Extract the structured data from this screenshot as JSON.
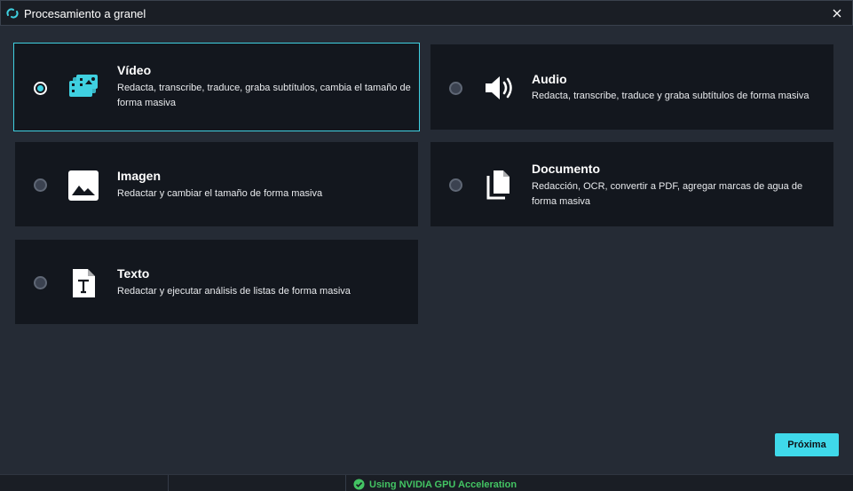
{
  "window": {
    "title": "Procesamiento a granel",
    "logo_icon": "app-logo-icon",
    "close_icon": "close-icon"
  },
  "options": [
    {
      "title": "Vídeo",
      "description": "Redacta, transcribe, traduce, graba subtítulos, cambia el tamaño de forma masiva",
      "icon": "video-batch-icon",
      "selected": true
    },
    {
      "title": "Audio",
      "description": "Redacta, transcribe, traduce y graba subtítulos de forma masiva",
      "icon": "speaker-icon",
      "selected": false
    },
    {
      "title": "Imagen",
      "description": "Redactar y cambiar el tamaño de forma masiva",
      "icon": "image-icon",
      "selected": false
    },
    {
      "title": "Documento",
      "description": "Redacción, OCR, convertir a PDF, agregar marcas de agua de forma masiva",
      "icon": "documents-icon",
      "selected": false
    },
    {
      "title": "Texto",
      "description": "Redactar y ejecutar análisis de listas de forma masiva",
      "icon": "text-file-icon",
      "selected": false
    }
  ],
  "actions": {
    "next_label": "Próxima"
  },
  "status": {
    "text": "Using NVIDIA GPU Acceleration",
    "icon": "check-circle-icon"
  },
  "colors": {
    "accent": "#3fd9ea",
    "card_bg": "#13171e",
    "window_bg": "#252b35",
    "status_green": "#43c463"
  }
}
